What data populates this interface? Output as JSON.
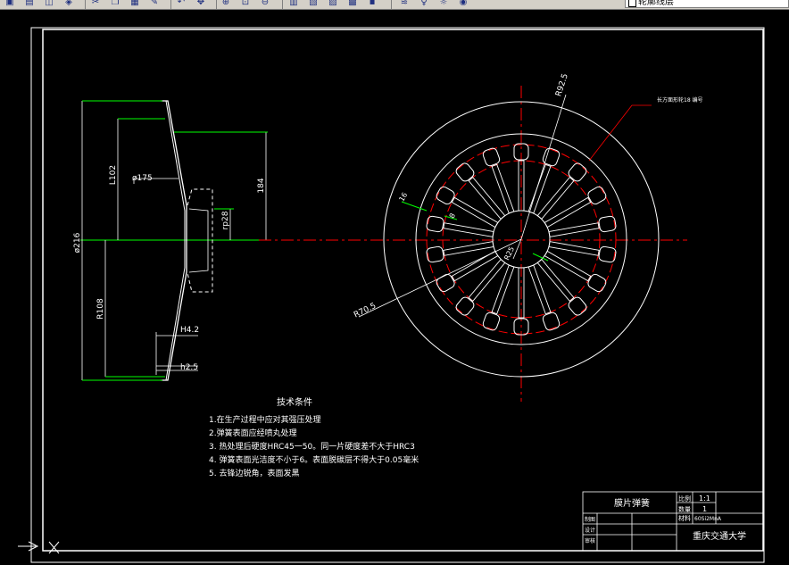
{
  "toolbar": {
    "buttons": [
      {
        "name": "save-icon",
        "glyph": "▣"
      },
      {
        "name": "print-icon",
        "glyph": "▤"
      },
      {
        "name": "preview-icon",
        "glyph": "◫"
      },
      {
        "name": "publish-icon",
        "glyph": "◈"
      },
      {
        "name": "cut-icon",
        "glyph": "✂"
      },
      {
        "name": "copy-icon",
        "glyph": "❐"
      },
      {
        "name": "paste-icon",
        "glyph": "▦"
      },
      {
        "name": "match-properties-icon",
        "glyph": "✎"
      },
      {
        "name": "undo-icon",
        "glyph": "↶"
      },
      {
        "name": "pan-icon",
        "glyph": "✥"
      },
      {
        "name": "zoom-realtime-icon",
        "glyph": "⊕"
      },
      {
        "name": "zoom-window-icon",
        "glyph": "⊡"
      },
      {
        "name": "zoom-previous-icon",
        "glyph": "⊖"
      },
      {
        "name": "properties-icon",
        "glyph": "▥"
      },
      {
        "name": "design-center-icon",
        "glyph": "▧"
      },
      {
        "name": "tool-palette-icon",
        "glyph": "▨"
      },
      {
        "name": "markup-icon",
        "glyph": "▩"
      },
      {
        "name": "calculator-icon",
        "glyph": "▪"
      },
      {
        "name": "layer-manager-icon",
        "glyph": "≋"
      },
      {
        "name": "layer-on-icon",
        "glyph": "♀"
      },
      {
        "name": "layer-freeze-icon",
        "glyph": "☼"
      },
      {
        "name": "layer-lock-icon",
        "glyph": "◉"
      }
    ],
    "layer_name": "轮廓线层"
  },
  "drawing": {
    "dims": {
      "d216": "ø216",
      "l102": "L102",
      "d175": "ø175",
      "r108": "R108",
      "d184": "184",
      "rp28": "rp28",
      "h42": "H4.2",
      "h25": "h2.5",
      "r92": "R92.5",
      "r70": "R70.5",
      "r25": "R25",
      "n16": "16",
      "n8": "8"
    },
    "leader_note": "长方面形轮18 编号",
    "tech_title": "技术条件",
    "tech_notes": [
      "1.在生产过程中应对其强压处理",
      "2.弹簧表面应经喷丸处理",
      "3. 热处理后硬度HRC45一50。同一片硬度差不大于HRC3",
      "4. 弹簧表面光洁度不小于6。表面脱碳层不得大于0.05毫米",
      "5. 去锋边锐角，表面发黑"
    ],
    "title_block": {
      "part_name": "膜片弹簧",
      "scale_label": "比例",
      "scale_value": "1:1",
      "qty_label": "数量",
      "qty_value": "1",
      "material_label": "材料",
      "material_value": "60Si2MnA",
      "drawn_label": "制图",
      "design_label": "设计",
      "review_label": "审核",
      "school": "重庆交通大学"
    }
  }
}
